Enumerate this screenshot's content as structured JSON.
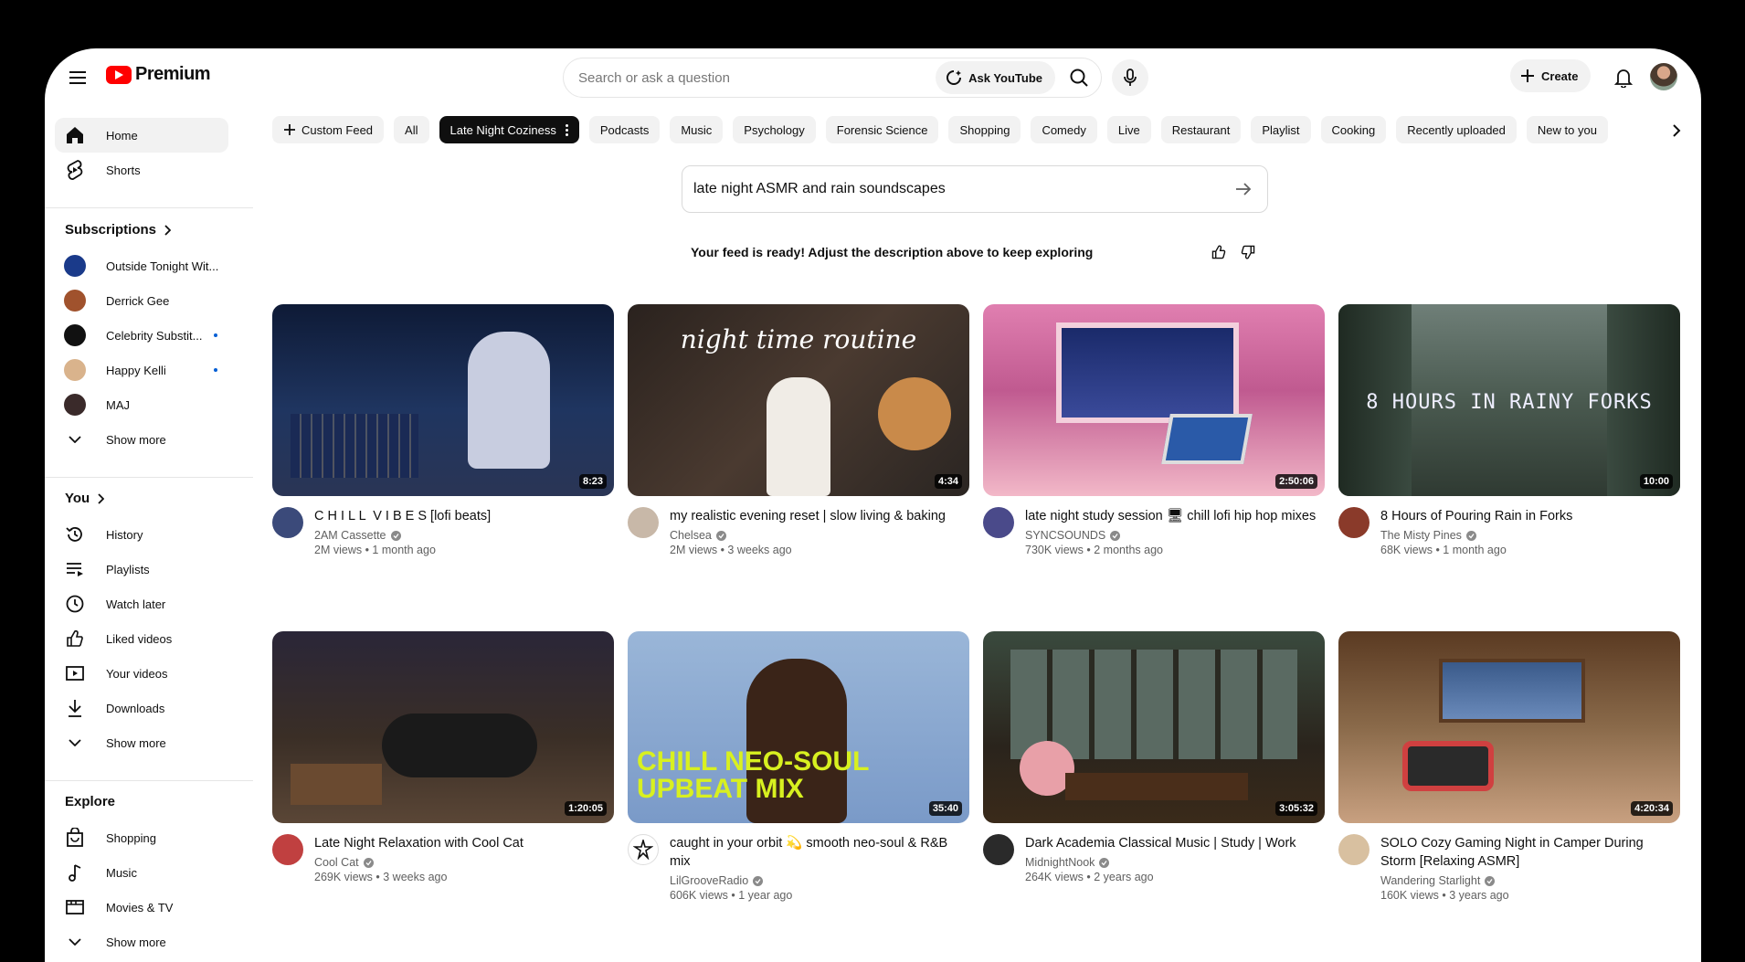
{
  "header": {
    "logo_text": "Premium",
    "search_placeholder": "Search or ask a question",
    "ask_label": "Ask YouTube",
    "create_label": "Create"
  },
  "sidebar": {
    "main": [
      {
        "label": "Home",
        "icon": "home-icon"
      },
      {
        "label": "Shorts",
        "icon": "shorts-icon"
      }
    ],
    "subscriptions_heading": "Subscriptions",
    "subscriptions": [
      {
        "label": "Outside Tonight Wit...",
        "new": false,
        "color": "#1a3a8a"
      },
      {
        "label": "Derrick Gee",
        "new": false,
        "color": "#a0522d"
      },
      {
        "label": "Celebrity Substit...",
        "new": true,
        "color": "#111111"
      },
      {
        "label": "Happy Kelli",
        "new": true,
        "color": "#d9b38c"
      },
      {
        "label": "MAJ",
        "new": false,
        "color": "#3a2a2a"
      }
    ],
    "show_more": "Show more",
    "you_heading": "You",
    "you_items": [
      {
        "label": "History",
        "icon": "history-icon"
      },
      {
        "label": "Playlists",
        "icon": "playlists-icon"
      },
      {
        "label": "Watch later",
        "icon": "watch-later-icon"
      },
      {
        "label": "Liked videos",
        "icon": "liked-icon"
      },
      {
        "label": "Your videos",
        "icon": "your-videos-icon"
      },
      {
        "label": "Downloads",
        "icon": "downloads-icon"
      }
    ],
    "explore_heading": "Explore",
    "explore_items": [
      {
        "label": "Shopping",
        "icon": "shopping-icon"
      },
      {
        "label": "Music",
        "icon": "music-icon"
      },
      {
        "label": "Movies & TV",
        "icon": "movies-icon"
      }
    ]
  },
  "chips": [
    "Custom Feed",
    "All",
    "Late Night Coziness",
    "Podcasts",
    "Music",
    "Psychology",
    "Forensic Science",
    "Shopping",
    "Comedy",
    "Live",
    "Restaurant",
    "Playlist",
    "Cooking",
    "Recently uploaded",
    "New to you"
  ],
  "active_chip": "Late Night Coziness",
  "prompt": {
    "value": "late night ASMR and rain soundscapes",
    "feed_message": "Your feed is ready! Adjust the description above to keep exploring"
  },
  "videos": [
    {
      "title": "C H I L L  V I B E S [lofi beats]",
      "channel": "2AM Cassette",
      "verified": true,
      "stats": "2M views • 1 month ago",
      "duration": "8:23",
      "thumb_bg": "#1b2a4a",
      "thumb_text": "",
      "avatar": "#3b4a7a"
    },
    {
      "title": "my realistic evening reset | slow living & baking",
      "channel": "Chelsea",
      "verified": true,
      "stats": "2M views • 3 weeks ago",
      "duration": "4:34",
      "thumb_bg": "#3a2e28",
      "thumb_text": "night time routine",
      "avatar": "#c8b8a8"
    },
    {
      "title": "late night study session 🖥 chill lofi hip hop mixes",
      "channel": "SYNCSOUNDS",
      "verified": true,
      "stats": "730K views • 2 months ago",
      "duration": "2:50:06",
      "thumb_bg": "#d97aa8",
      "thumb_text": "",
      "avatar": "#4a4a8a"
    },
    {
      "title": "8 Hours of Pouring Rain in Forks",
      "channel": "The Misty Pines",
      "verified": true,
      "stats": "68K views • 1 month ago",
      "duration": "10:00",
      "thumb_bg": "#4a5a50",
      "thumb_text": "8 HOURS IN RAINY FORKS",
      "avatar": "#8a3a2a"
    },
    {
      "title": "Late Night Relaxation with Cool Cat",
      "channel": "Cool Cat",
      "verified": true,
      "stats": "269K views • 3 weeks ago",
      "duration": "1:20:05",
      "thumb_bg": "#3a2e26",
      "thumb_text": "",
      "avatar": "#c04040"
    },
    {
      "title": "caught in your orbit 💫 smooth neo-soul & R&B mix",
      "channel": "LilGrooveRadio",
      "verified": true,
      "stats": "606K views • 1 year ago",
      "duration": "35:40",
      "thumb_bg": "#8aaad0",
      "thumb_text": "CHILL NEO-SOUL UPBEAT MIX",
      "avatar": "#ffffff"
    },
    {
      "title": "Dark Academia Classical Music | Study | Work",
      "channel": "MidnightNook",
      "verified": true,
      "stats": "264K views • 2 years ago",
      "duration": "3:05:32",
      "thumb_bg": "#3a3a2a",
      "thumb_text": "",
      "avatar": "#2a2a2a"
    },
    {
      "title": "SOLO Cozy Gaming Night in Camper During Storm [Relaxing ASMR]",
      "channel": "Wandering Starlight",
      "verified": true,
      "stats": "160K views • 3 years ago",
      "duration": "4:20:34",
      "thumb_bg": "#6a4a30",
      "thumb_text": "",
      "avatar": "#d8c0a0"
    }
  ]
}
